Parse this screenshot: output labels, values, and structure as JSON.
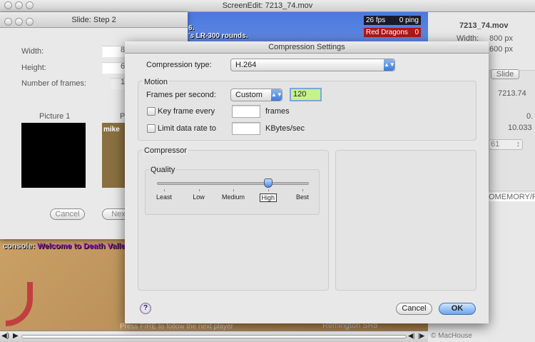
{
  "main_window": {
    "title": "ScreenEdit: 7213_74.mov"
  },
  "video": {
    "fps": "26 fps",
    "ping": "0 ping",
    "team": "Red Dragons",
    "team_score": "0",
    "console_prefix": "console:",
    "console_msg": "Welcome to Death Valle",
    "text1": "6.",
    "text2": "'s LR-300 rounds.",
    "weapon": "Remington SR8",
    "press_text": "Press FIRE to follow the next player",
    "player_name": "mike"
  },
  "info_panel": {
    "filename": "7213_74.mov",
    "width_label": "Width:",
    "width_value": "800",
    "height_value": "600",
    "unit": "px",
    "tab_slide": "Slide",
    "value1": "7213.74",
    "value2": "0.",
    "value3": "10.033",
    "popup_value": "61",
    "path": "OMEMORY/RE",
    "copyright": "© MacHouse"
  },
  "slide_dialog": {
    "title": "Slide: Step 2",
    "width_label": "Width:",
    "width_value": "8",
    "height_label": "Height:",
    "height_value": "6",
    "frames_label": "Number of frames:",
    "frames_value": "1",
    "picture1_label": "Picture 1",
    "picture2_label": "P",
    "cancel": "Cancel",
    "next": "Next"
  },
  "compression": {
    "title": "Compression Settings",
    "type_label": "Compression type:",
    "type_value": "H.264",
    "motion_label": "Motion",
    "fps_label": "Frames per second:",
    "fps_popup": "Custom",
    "fps_value": "120",
    "keyframe_label": "Key frame every",
    "keyframe_value": "",
    "keyframe_unit": "frames",
    "limit_label": "Limit data rate to",
    "limit_value": "",
    "limit_unit": "KBytes/sec",
    "compressor_label": "Compressor",
    "quality_label": "Quality",
    "quality_ticks": [
      "Least",
      "Low",
      "Medium",
      "High",
      "Best"
    ],
    "quality_selected": "High",
    "quality_fraction": 0.75,
    "cancel": "Cancel",
    "ok": "OK",
    "help": "?"
  }
}
